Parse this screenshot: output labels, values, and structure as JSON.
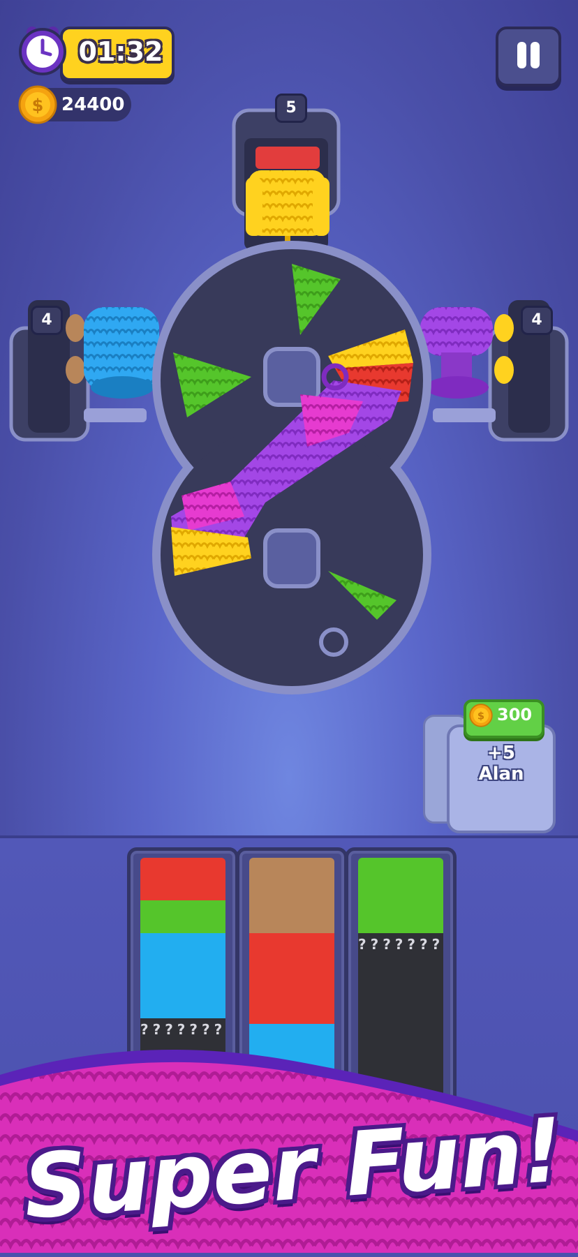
{
  "hud": {
    "timer": "01:32",
    "coins": "24400",
    "timer_icon": "alarm-clock-icon",
    "coin_icon": "coin-icon",
    "pause_icon": "pause-icon"
  },
  "spools": [
    {
      "position": "top",
      "count": "5",
      "yarn_color": "#ffd21f"
    },
    {
      "position": "left",
      "count": "4",
      "yarn_color": "#2fa8f2"
    },
    {
      "position": "right",
      "count": "4",
      "yarn_color": "#a347e6"
    }
  ],
  "shop": {
    "price": "300",
    "label_line1": "+5",
    "label_line2": "Alan"
  },
  "columns": [
    {
      "segments": [
        {
          "color": "#e8392f",
          "type": "yarn",
          "fraction": 0.17
        },
        {
          "color": "#55c52b",
          "type": "yarn",
          "fraction": 0.13
        },
        {
          "color": "#22aef0",
          "type": "yarn",
          "fraction": 0.34
        },
        {
          "color": "#2f3036",
          "type": "mystery",
          "fraction": 0.36
        }
      ]
    },
    {
      "segments": [
        {
          "color": "#b8865a",
          "type": "yarn",
          "fraction": 0.3
        },
        {
          "color": "#e8392f",
          "type": "yarn",
          "fraction": 0.36
        },
        {
          "color": "#22aef0",
          "type": "yarn",
          "fraction": 0.34
        }
      ]
    },
    {
      "segments": [
        {
          "color": "#55c52b",
          "type": "yarn",
          "fraction": 0.3
        },
        {
          "color": "#2f3036",
          "type": "mystery",
          "fraction": 0.7
        }
      ]
    }
  ],
  "mystery_symbol": "?",
  "banner": {
    "text": "Super Fun!"
  },
  "colors": {
    "background": "#5a66c9",
    "track": "#3c3f60",
    "yarn_yellow": "#ffd21f",
    "yarn_green": "#55c52b",
    "yarn_pink": "#e63bd0",
    "yarn_purple": "#a347e6",
    "yarn_red": "#e8392f",
    "yarn_blue": "#22aef0",
    "yarn_brown": "#b8865a",
    "banner_pink": "#d92fb9"
  }
}
